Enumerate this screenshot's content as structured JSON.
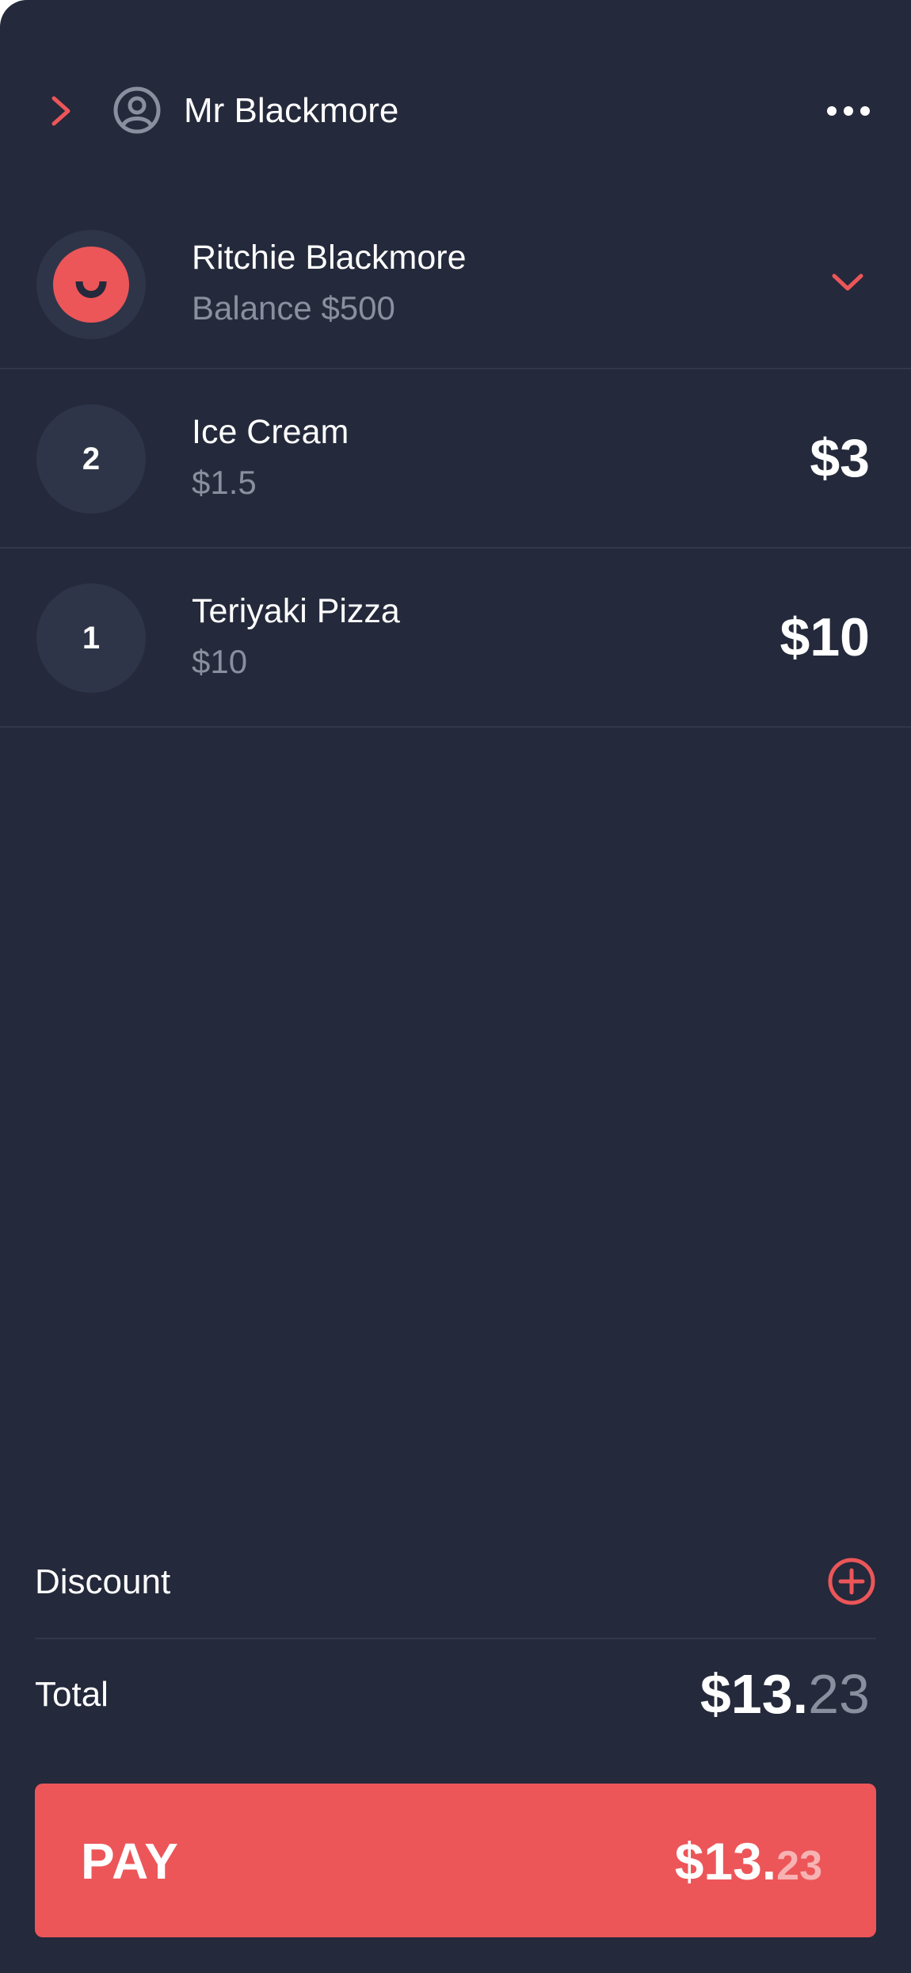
{
  "colors": {
    "background": "#24293b",
    "accent": "#ec5659",
    "text_primary": "#ffffff",
    "text_muted": "#8a8f9f",
    "badge_bg": "#2f3548",
    "divider": "#323849"
  },
  "header": {
    "back_icon": "chevron-right-icon",
    "user_icon": "account-circle-icon",
    "title": "Mr Blackmore",
    "more_icon": "more-horizontal-icon"
  },
  "customer": {
    "avatar_icon": "smiley-avatar-icon",
    "name": "Ritchie Blackmore",
    "balance": "Balance $500",
    "expand_icon": "chevron-down-icon"
  },
  "items": [
    {
      "quantity": "2",
      "name": "Ice Cream",
      "unit_price": "$1.5",
      "line_total": "$3"
    },
    {
      "quantity": "1",
      "name": "Teriyaki Pizza",
      "unit_price": "$10",
      "line_total": "$10"
    }
  ],
  "discount": {
    "label": "Discount",
    "add_icon": "add-circle-icon"
  },
  "total": {
    "label": "Total",
    "whole": "$13.",
    "cents": "23"
  },
  "pay": {
    "label": "PAY",
    "whole": "$13.",
    "cents": "23"
  }
}
